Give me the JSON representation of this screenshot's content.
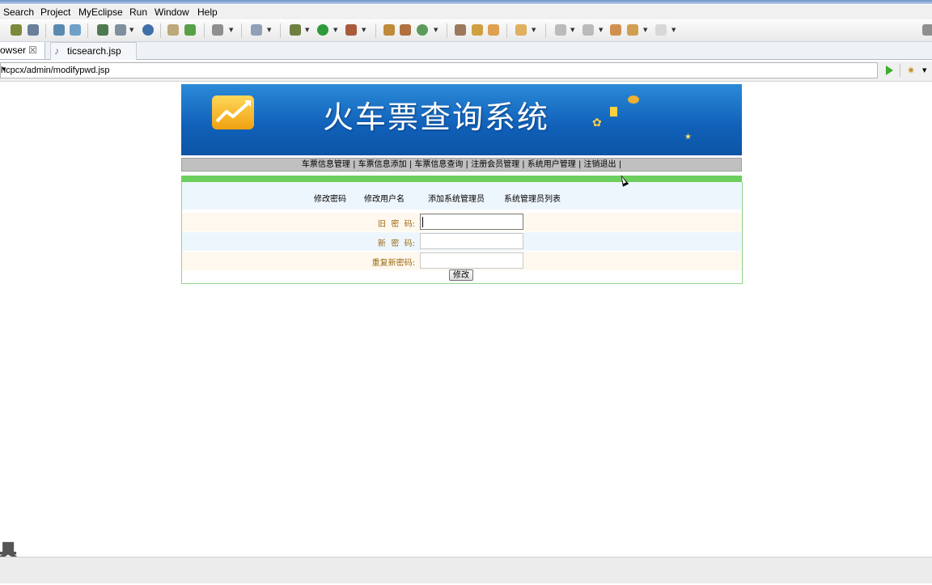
{
  "menu": {
    "items": [
      {
        "label": "Search"
      },
      {
        "label": "Project"
      },
      {
        "label": "MyEclipse"
      },
      {
        "label": "Run"
      },
      {
        "label": "Window"
      },
      {
        "label": "Help"
      }
    ]
  },
  "tabs": {
    "browser": {
      "label": "owser"
    },
    "file": {
      "label": "ticsearch.jsp"
    }
  },
  "address": {
    "url": "hcpcx/admin/modifypwd.jsp"
  },
  "site": {
    "title": "火车票查询系统",
    "nav": "车票信息管理 | 车票信息添加 | 车票信息查询 | 注册会员管理 | 系统用户管理 | 注销退出 |"
  },
  "admin_links": [
    {
      "label": "修改密码"
    },
    {
      "label": "修改用户名"
    },
    {
      "label": "添加系统管理员"
    },
    {
      "label": "系统管理员列表"
    }
  ],
  "form": {
    "old_password_label": "旧  密  码:",
    "new_password_label": "新  密  码:",
    "repeat_password_label": "重复新密码:",
    "old_password_value": "",
    "new_password_value": "",
    "repeat_password_value": "",
    "submit_label": "修改"
  },
  "watermark": {
    "text": "具\n软机"
  },
  "colors": {
    "banner_blue": "#1a72c8",
    "accent_green": "#6ccf5e",
    "label_brown": "#9a6a14"
  }
}
